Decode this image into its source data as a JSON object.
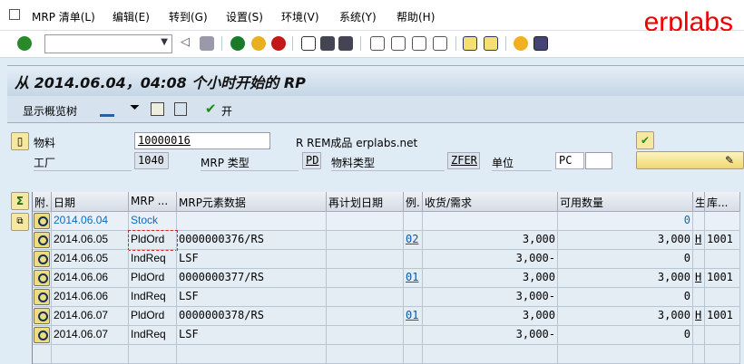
{
  "menu": [
    "MRP 清单(L)",
    "编辑(E)",
    "转到(G)",
    "设置(S)",
    "环境(V)",
    "系统(Y)",
    "帮助(H)"
  ],
  "brand": "erplabs",
  "command_field": "",
  "title": "从 2014.06.04，04:08 个小时开始的 RP",
  "app_toolbar": {
    "overview_tree": "显示概览树",
    "open": "开"
  },
  "header": {
    "material_label": "物料",
    "material": "10000016",
    "material_desc": "R REM成品 erplabs.net",
    "plant_label": "工厂",
    "plant": "1040",
    "mrp_type_label": "MRP 类型",
    "mrp_type": "PD",
    "material_type_label": "物料类型",
    "material_type": "ZFER",
    "unit_label": "单位",
    "unit": "PC"
  },
  "columns": [
    "附.",
    "日期",
    "MRP ...",
    "MRP元素数据",
    "再计划日期",
    "例.",
    "收货/需求",
    "可用数量",
    "生",
    "库..."
  ],
  "rows": [
    {
      "date": "2014.06.04",
      "mrp": "Stock",
      "elem": "",
      "resched": "",
      "exc": "",
      "qty": "",
      "avail": "0",
      "prod": "",
      "stor": ""
    },
    {
      "date": "2014.06.05",
      "mrp": "PldOrd",
      "elem": "0000000376/RS",
      "resched": "",
      "exc": "02",
      "qty": "3,000",
      "avail": "3,000",
      "prod": "H",
      "stor": "1001"
    },
    {
      "date": "2014.06.05",
      "mrp": "IndReq",
      "elem": "LSF",
      "resched": "",
      "exc": "",
      "qty": "3,000-",
      "avail": "0",
      "prod": "",
      "stor": ""
    },
    {
      "date": "2014.06.06",
      "mrp": "PldOrd",
      "elem": "0000000377/RS",
      "resched": "",
      "exc": "01",
      "qty": "3,000",
      "avail": "3,000",
      "prod": "H",
      "stor": "1001"
    },
    {
      "date": "2014.06.06",
      "mrp": "IndReq",
      "elem": "LSF",
      "resched": "",
      "exc": "",
      "qty": "3,000-",
      "avail": "0",
      "prod": "",
      "stor": ""
    },
    {
      "date": "2014.06.07",
      "mrp": "PldOrd",
      "elem": "0000000378/RS",
      "resched": "",
      "exc": "01",
      "qty": "3,000",
      "avail": "3,000",
      "prod": "H",
      "stor": "1001"
    },
    {
      "date": "2014.06.07",
      "mrp": "IndReq",
      "elem": "LSF",
      "resched": "",
      "exc": "",
      "qty": "3,000-",
      "avail": "0",
      "prod": "",
      "stor": ""
    }
  ]
}
